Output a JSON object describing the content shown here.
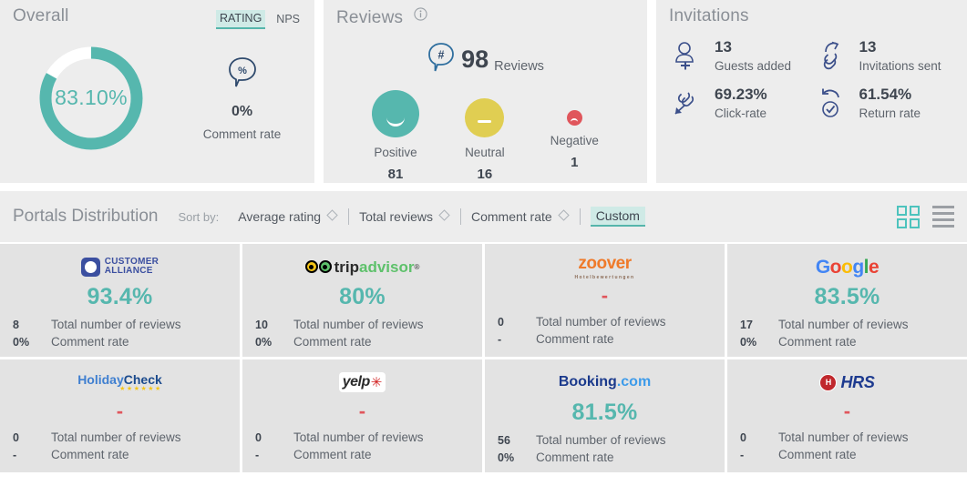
{
  "overall": {
    "title": "Overall",
    "toggle": {
      "rating": "RATING",
      "nps": "NPS",
      "active": "RATING"
    },
    "score": "83.10%",
    "score_value": 83.1,
    "comment_rate_value": "0%",
    "comment_rate_label": "Comment rate",
    "accent_color": "#56b7ae"
  },
  "reviews": {
    "title": "Reviews",
    "count": "98",
    "count_label": "Reviews",
    "breakdown": [
      {
        "label": "Positive",
        "value": "81",
        "color": "#56b7ae",
        "face": "smile"
      },
      {
        "label": "Neutral",
        "value": "16",
        "color": "#e0ce52",
        "face": "flat"
      },
      {
        "label": "Negative",
        "value": "1",
        "color": "#e0565c",
        "face": "frown"
      }
    ]
  },
  "invitations": {
    "title": "Invitations",
    "items": [
      {
        "icon": "add-guest-icon",
        "value": "13",
        "label": "Guests added"
      },
      {
        "icon": "invitation-sent-icon",
        "value": "13",
        "label": "Invitations sent"
      },
      {
        "icon": "click-rate-icon",
        "value": "69.23%",
        "label": "Click-rate"
      },
      {
        "icon": "return-rate-icon",
        "value": "61.54%",
        "label": "Return rate"
      }
    ]
  },
  "portals": {
    "title": "Portals Distribution",
    "sort_by_label": "Sort by:",
    "sort_options": [
      {
        "label": "Average rating",
        "active": false
      },
      {
        "label": "Total reviews",
        "active": false
      },
      {
        "label": "Comment rate",
        "active": false
      }
    ],
    "custom_option": {
      "label": "Custom",
      "active": true
    },
    "views": [
      {
        "name": "grid-view-icon",
        "active": true
      },
      {
        "name": "list-view-icon",
        "active": false
      }
    ],
    "metric_labels": {
      "total_reviews": "Total number of reviews",
      "comment_rate": "Comment rate"
    },
    "cards": [
      {
        "brand": "Customer Alliance",
        "logo": "customer-alliance-logo",
        "score": "93.4%",
        "has_score": true,
        "total_reviews": "8",
        "comment_rate": "0%"
      },
      {
        "brand": "TripAdvisor",
        "logo": "tripadvisor-logo",
        "score": "80%",
        "has_score": true,
        "total_reviews": "10",
        "comment_rate": "0%"
      },
      {
        "brand": "Zoover",
        "logo": "zoover-logo",
        "score": "-",
        "has_score": false,
        "total_reviews": "0",
        "comment_rate": "-"
      },
      {
        "brand": "Google",
        "logo": "google-logo",
        "score": "83.5%",
        "has_score": true,
        "total_reviews": "17",
        "comment_rate": "0%"
      },
      {
        "brand": "HolidayCheck",
        "logo": "holidaycheck-logo",
        "score": "-",
        "has_score": false,
        "total_reviews": "0",
        "comment_rate": "-"
      },
      {
        "brand": "Yelp",
        "logo": "yelp-logo",
        "score": "-",
        "has_score": false,
        "total_reviews": "0",
        "comment_rate": "-"
      },
      {
        "brand": "Booking.com",
        "logo": "booking-logo",
        "score": "81.5%",
        "has_score": true,
        "total_reviews": "56",
        "comment_rate": "0%"
      },
      {
        "brand": "HRS",
        "logo": "hrs-logo",
        "score": "-",
        "has_score": false,
        "total_reviews": "0",
        "comment_rate": "-"
      }
    ],
    "logo_text": {
      "customer_alliance_1": "CUSTOMER",
      "customer_alliance_2": "ALLIANCE",
      "tripadvisor_1": "trip",
      "tripadvisor_2": "advisor",
      "tripadvisor_3": "®",
      "zoover_1": "zoover",
      "zoover_2": "Hotelbewertungen",
      "google_g1": "G",
      "google_o1": "o",
      "google_o2": "o",
      "google_g2": "g",
      "google_l": "l",
      "google_e": "e",
      "holidaycheck_1": "Holiday",
      "holidaycheck_2": "Check",
      "holidaycheck_stars": "★★★★★★",
      "yelp_1": "yelp",
      "yelp_2": "✳",
      "booking_1": "Booking",
      "booking_2": ".com",
      "hrs_1": "H",
      "hrs_2": "HRS"
    }
  }
}
